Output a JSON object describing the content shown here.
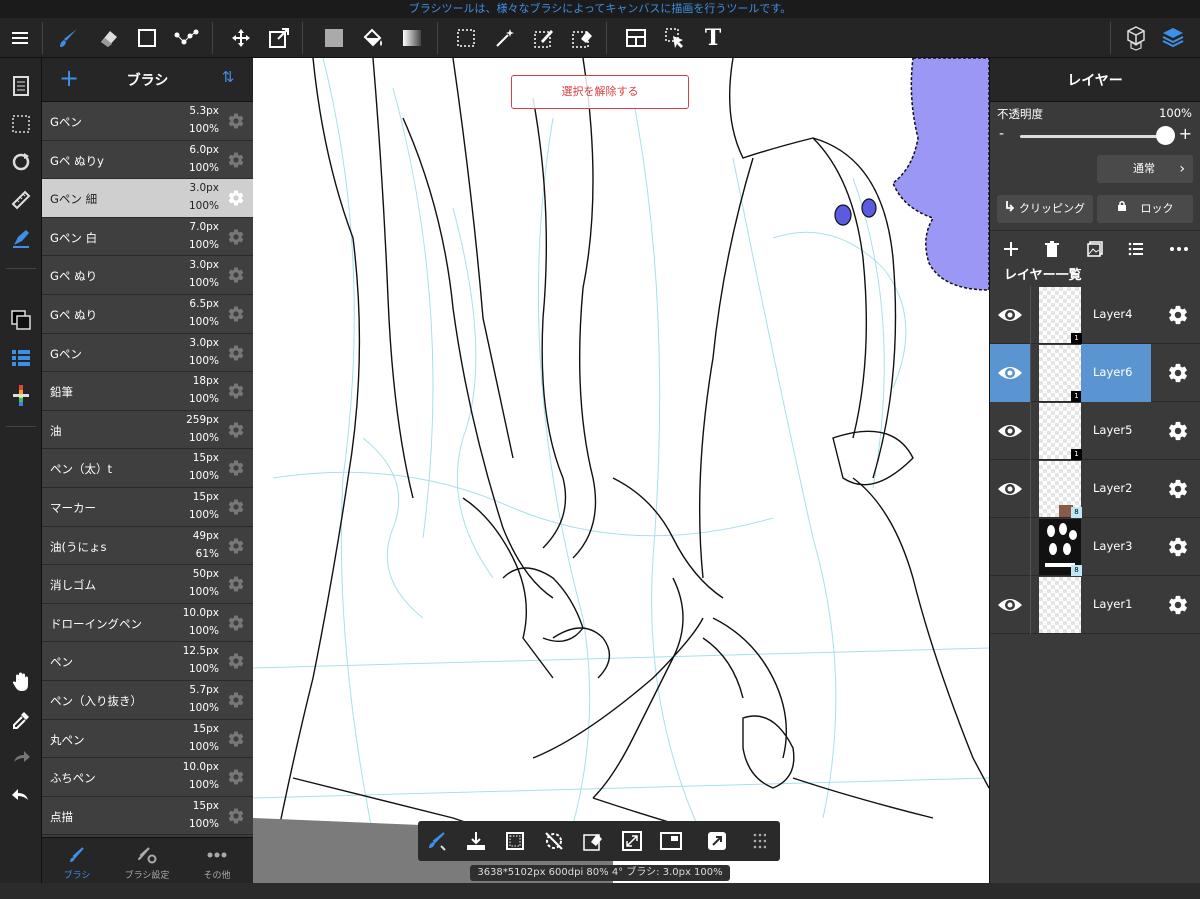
{
  "status_banner": "ブラシツールは、様々なブラシによってキャンバスに描画を行うツールです。",
  "toolbar": {
    "icons": [
      "menu-icon",
      "brush-icon",
      "eraser-icon",
      "rectangle-icon",
      "dot-line-icon",
      "move-icon",
      "transform-icon",
      "fill-color-icon",
      "bucket-icon",
      "gradient-icon",
      "select-rect-icon",
      "magic-wand-icon",
      "select-pen-icon",
      "select-eraser-icon",
      "layout-icon",
      "select-move-icon",
      "text-icon",
      "3d-icon",
      "layers-icon"
    ],
    "text_tool_glyph": "T"
  },
  "brush_panel": {
    "title": "ブラシ",
    "add_glyph": "+",
    "sort_glyph": "⇅",
    "items": [
      {
        "name": "Gペン",
        "size": "5.3px",
        "opacity": "100%"
      },
      {
        "name": "Gペ ぬりy",
        "size": "6.0px",
        "opacity": "100%"
      },
      {
        "name": "Gペン 細",
        "size": "3.0px",
        "opacity": "100%"
      },
      {
        "name": "Gペン 白",
        "size": "7.0px",
        "opacity": "100%"
      },
      {
        "name": "Gペ ぬり",
        "size": "3.0px",
        "opacity": "100%"
      },
      {
        "name": "Gペ ぬり",
        "size": "6.5px",
        "opacity": "100%"
      },
      {
        "name": "Gペン",
        "size": "3.0px",
        "opacity": "100%"
      },
      {
        "name": "鉛筆",
        "size": "18px",
        "opacity": "100%"
      },
      {
        "name": "油",
        "size": "259px",
        "opacity": "100%"
      },
      {
        "name": "ペン（太）t",
        "size": "15px",
        "opacity": "100%"
      },
      {
        "name": "マーカー",
        "size": "15px",
        "opacity": "100%"
      },
      {
        "name": "油(うにょs",
        "size": "49px",
        "opacity": "61%"
      },
      {
        "name": "消しゴム",
        "size": "50px",
        "opacity": "100%"
      },
      {
        "name": "ドローイングペン",
        "size": "10.0px",
        "opacity": "100%"
      },
      {
        "name": "ペン",
        "size": "12.5px",
        "opacity": "100%"
      },
      {
        "name": "ペン（入り抜き）",
        "size": "5.7px",
        "opacity": "100%"
      },
      {
        "name": "丸ペン",
        "size": "15px",
        "opacity": "100%"
      },
      {
        "name": "ふちペン",
        "size": "10.0px",
        "opacity": "100%"
      },
      {
        "name": "点描",
        "size": "15px",
        "opacity": "100%"
      }
    ],
    "tabs": [
      {
        "label": "ブラシ",
        "icon": "brush-tab-icon"
      },
      {
        "label": "ブラシ設定",
        "icon": "brush-settings-icon"
      },
      {
        "label": "その他",
        "icon": "more-icon"
      }
    ]
  },
  "canvas": {
    "deselect_label": "選択を解除する",
    "info": "3638*5102px 600dpi 80% 4° ブラシ: 3.0px 100%"
  },
  "layer_panel": {
    "title": "レイヤー",
    "opacity_label": "不透明度",
    "opacity_value": "100%",
    "opacity_fraction": 1.0,
    "minus": "-",
    "plus": "+",
    "blend_mode": "通常",
    "clipping_label": "クリッピング",
    "lock_label": "ロック",
    "list_title": "レイヤー一覧",
    "layers": [
      {
        "name": "Layer4",
        "visible": true,
        "badge": "1"
      },
      {
        "name": "Layer6",
        "visible": true,
        "badge": "1",
        "selected": true
      },
      {
        "name": "Layer5",
        "visible": true,
        "badge": "1"
      },
      {
        "name": "Layer2",
        "visible": true,
        "badge": "8"
      },
      {
        "name": "Layer3",
        "visible": false,
        "badge": "8"
      },
      {
        "name": "Layer1",
        "visible": true,
        "badge": ""
      }
    ]
  },
  "colors": {
    "accent": "#3e8fe6",
    "selected_layer": "#5b95d1",
    "deselect_red": "#d94040",
    "fill_purple": "#9a97f5"
  }
}
